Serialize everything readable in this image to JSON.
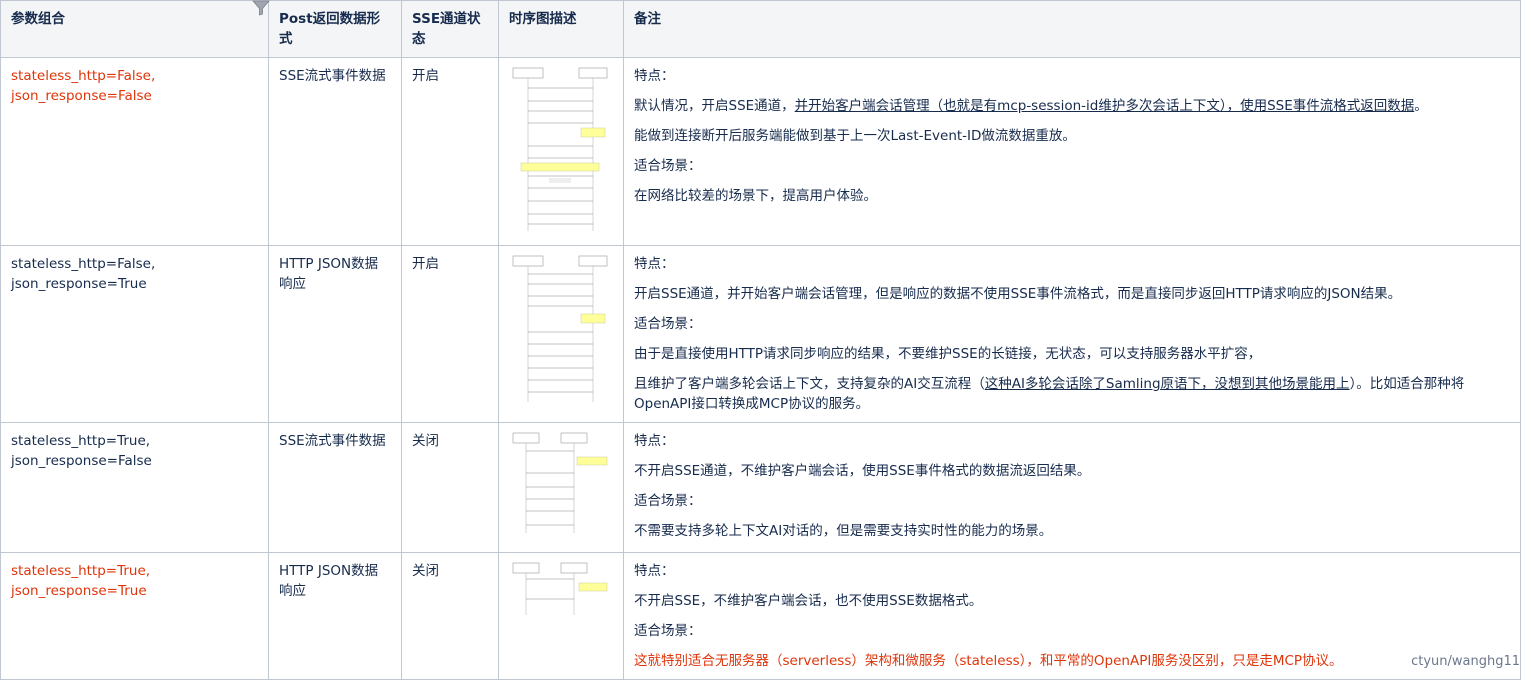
{
  "headers": [
    "参数组合",
    "Post返回数据形式",
    "SSE通道状态",
    "时序图描述",
    "备注"
  ],
  "rows": [
    {
      "param": "stateless_http=False,\njson_response=False",
      "param_red": true,
      "post": "SSE流式事件数据",
      "sse": "开启",
      "diagram": "sequence-diagram-thumbnail-1",
      "notes": {
        "p1": "特点：",
        "p2_a": "默认情况，开启SSE通道，",
        "p2_u": "并开始客户端会话管理（也就是有mcp-session-id维护多次会话上下文），使用SSE事件流格式返回数据",
        "p2_b": "。",
        "p3": "能做到连接断开后服务端能做到基于上一次Last-Event-ID做流数据重放。",
        "p4": "适合场景：",
        "p5": "在网络比较差的场景下，提高用户体验。"
      }
    },
    {
      "param": "stateless_http=False,\njson_response=True",
      "param_red": false,
      "post": "HTTP JSON数据响应",
      "sse": "开启",
      "diagram": "sequence-diagram-thumbnail-2",
      "notes": {
        "p1": "特点：",
        "p2": "开启SSE通道，并开始客户端会话管理，但是响应的数据不使用SSE事件流格式，而是直接同步返回HTTP请求响应的JSON结果。",
        "p3": "适合场景：",
        "p4": "由于是直接使用HTTP请求同步响应的结果，不要维护SSE的长链接，无状态，可以支持服务器水平扩容，",
        "p5_a": "且维护了客户端多轮会话上下文，支持复杂的AI交互流程（",
        "p5_u": "这种AI多轮会话除了Samling原语下，没想到其他场景能用上",
        "p5_b": "）。比如适合那种将OpenAPI接口转换成MCP协议的服务。"
      }
    },
    {
      "param": "stateless_http=True,\njson_response=False",
      "param_red": false,
      "post": "SSE流式事件数据",
      "sse": "关闭",
      "diagram": "sequence-diagram-thumbnail-3",
      "notes": {
        "p1": "特点：",
        "p2": "不开启SSE通道，不维护客户端会话，使用SSE事件格式的数据流返回结果。",
        "p3": "适合场景：",
        "p4": "不需要支持多轮上下文AI对话的，但是需要支持实时性的能力的场景。"
      }
    },
    {
      "param": "stateless_http=True,\njson_response=True",
      "param_red": true,
      "post": "HTTP JSON数据响应",
      "sse": "关闭",
      "diagram": "sequence-diagram-thumbnail-4",
      "notes": {
        "p1": "特点：",
        "p2": "不开启SSE，不维护客户端会话，也不使用SSE数据格式。",
        "p3": "适合场景：",
        "p4": "这就特别适合无服务器（serverless）架构和微服务（stateless），和平常的OpenAPI服务没区别，只是走MCP协议。"
      }
    }
  ],
  "credit": "ctyun/wanghg11",
  "colors": {
    "header_bg": "#f4f5f7",
    "border": "#c1c7d0",
    "red": "#de350b",
    "text": "#172b4d"
  }
}
